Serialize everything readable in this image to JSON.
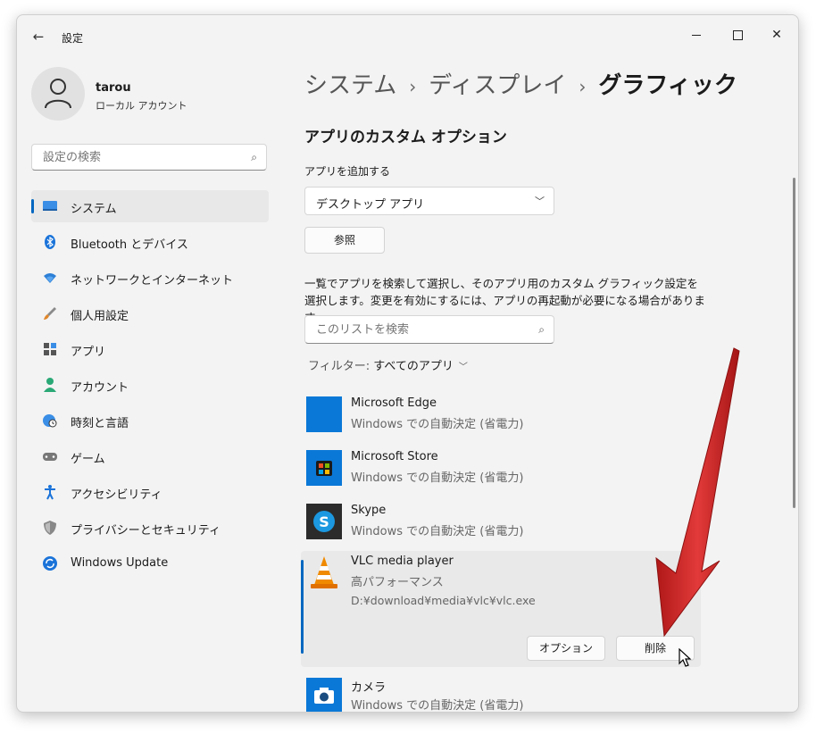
{
  "window": {
    "title": "設定"
  },
  "user": {
    "name": "tarou",
    "account_type": "ローカル アカウント"
  },
  "sidebar": {
    "search_placeholder": "設定の検索",
    "items": [
      {
        "label": "システム",
        "icon": "monitor-icon",
        "active": true
      },
      {
        "label": "Bluetooth とデバイス",
        "icon": "bluetooth-icon"
      },
      {
        "label": "ネットワークとインターネット",
        "icon": "wifi-icon"
      },
      {
        "label": "個人用設定",
        "icon": "brush-icon"
      },
      {
        "label": "アプリ",
        "icon": "apps-icon"
      },
      {
        "label": "アカウント",
        "icon": "person-icon"
      },
      {
        "label": "時刻と言語",
        "icon": "globe-clock-icon"
      },
      {
        "label": "ゲーム",
        "icon": "gamepad-icon"
      },
      {
        "label": "アクセシビリティ",
        "icon": "accessibility-icon"
      },
      {
        "label": "プライバシーとセキュリティ",
        "icon": "shield-icon"
      },
      {
        "label": "Windows Update",
        "icon": "update-icon"
      }
    ]
  },
  "breadcrumb": {
    "items": [
      "システム",
      "ディスプレイ",
      "グラフィック"
    ],
    "separator": "›"
  },
  "main": {
    "section_title": "アプリのカスタム オプション",
    "add_app_label": "アプリを追加する",
    "app_type_value": "デスクトップ アプリ",
    "browse_label": "参照",
    "description": "一覧でアプリを検索して選択し、そのアプリ用のカスタム グラフィック設定を選択します。変更を有効にするには、アプリの再起動が必要になる場合があります。",
    "list_search_placeholder": "このリストを検索",
    "filter_label": "フィルター: ",
    "filter_value": "すべてのアプリ",
    "apps": [
      {
        "name": "Microsoft Edge",
        "setting": "Windows での自動決定 (省電力)",
        "icon": "edge-icon"
      },
      {
        "name": "Microsoft Store",
        "setting": "Windows での自動決定 (省電力)",
        "icon": "store-icon"
      },
      {
        "name": "Skype",
        "setting": "Windows での自動決定 (省電力)",
        "icon": "skype-icon"
      },
      {
        "name": "VLC media player",
        "setting": "高パフォーマンス",
        "path": "D:¥download¥media¥vlc¥vlc.exe",
        "icon": "vlc-cone-icon",
        "expanded": true,
        "options_label": "オプション",
        "remove_label": "削除"
      },
      {
        "name": "カメラ",
        "setting": "Windows での自動決定 (省電力)",
        "icon": "camera-icon"
      }
    ]
  },
  "colors": {
    "accent": "#0067c0",
    "window_bg": "#f3f3f3",
    "arrow": "#d42a2a"
  }
}
